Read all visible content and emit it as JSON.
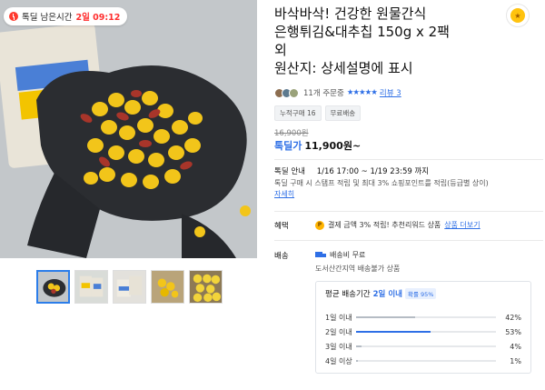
{
  "deal_timer": {
    "label": "톡딜 남은시간",
    "time": "2일 09:12"
  },
  "product": {
    "title_line1": "바삭바삭! 건강한 원물간식",
    "title_line2": "은행튀김&대추칩 150g x 2팩",
    "title_line3": "외",
    "title_line4": "원산지: 상세설명에 표시",
    "brand_logo_text": "★"
  },
  "reviews": {
    "count_label": "11개 주문중",
    "stars": "★★★★★",
    "review_link": "리뷰 3"
  },
  "tags": [
    "누적구매 16",
    "무료배송"
  ],
  "price": {
    "original": "16,900원",
    "deal_label": "톡딜가",
    "deal_price": "11,900원~"
  },
  "deal_info": {
    "label": "톡딜 안내",
    "dates": "1/16 17:00 ~ 1/19 23:59 까지",
    "desc": "톡딜 구매 시 스탬프 적립 및 최대 3% 쇼핑포인트를 적립(등급별 상이)",
    "more": "자세히"
  },
  "benefit": {
    "label": "혜택",
    "text": "결제 금액 3% 적립! 추천리워드 상품",
    "more": "상품 더보기"
  },
  "shipping": {
    "label": "배송",
    "fee": "배송비 무료",
    "note": "도서산간지역 배송불가 상품",
    "avg_label": "평균 배송기간",
    "avg_value": "2일 이내",
    "avg_pill": "확률 95%",
    "rows": [
      {
        "name": "1일 이내",
        "pct": "42%",
        "value": 42
      },
      {
        "name": "2일 이내",
        "pct": "53%",
        "value": 53
      },
      {
        "name": "3일 이내",
        "pct": "4%",
        "value": 4
      },
      {
        "name": "4일 이상",
        "pct": "1%",
        "value": 1
      }
    ]
  },
  "colors": {
    "accent": "#2e6fe6",
    "timer_red": "#ff2e2e",
    "brand_yellow": "#ffc30f"
  }
}
